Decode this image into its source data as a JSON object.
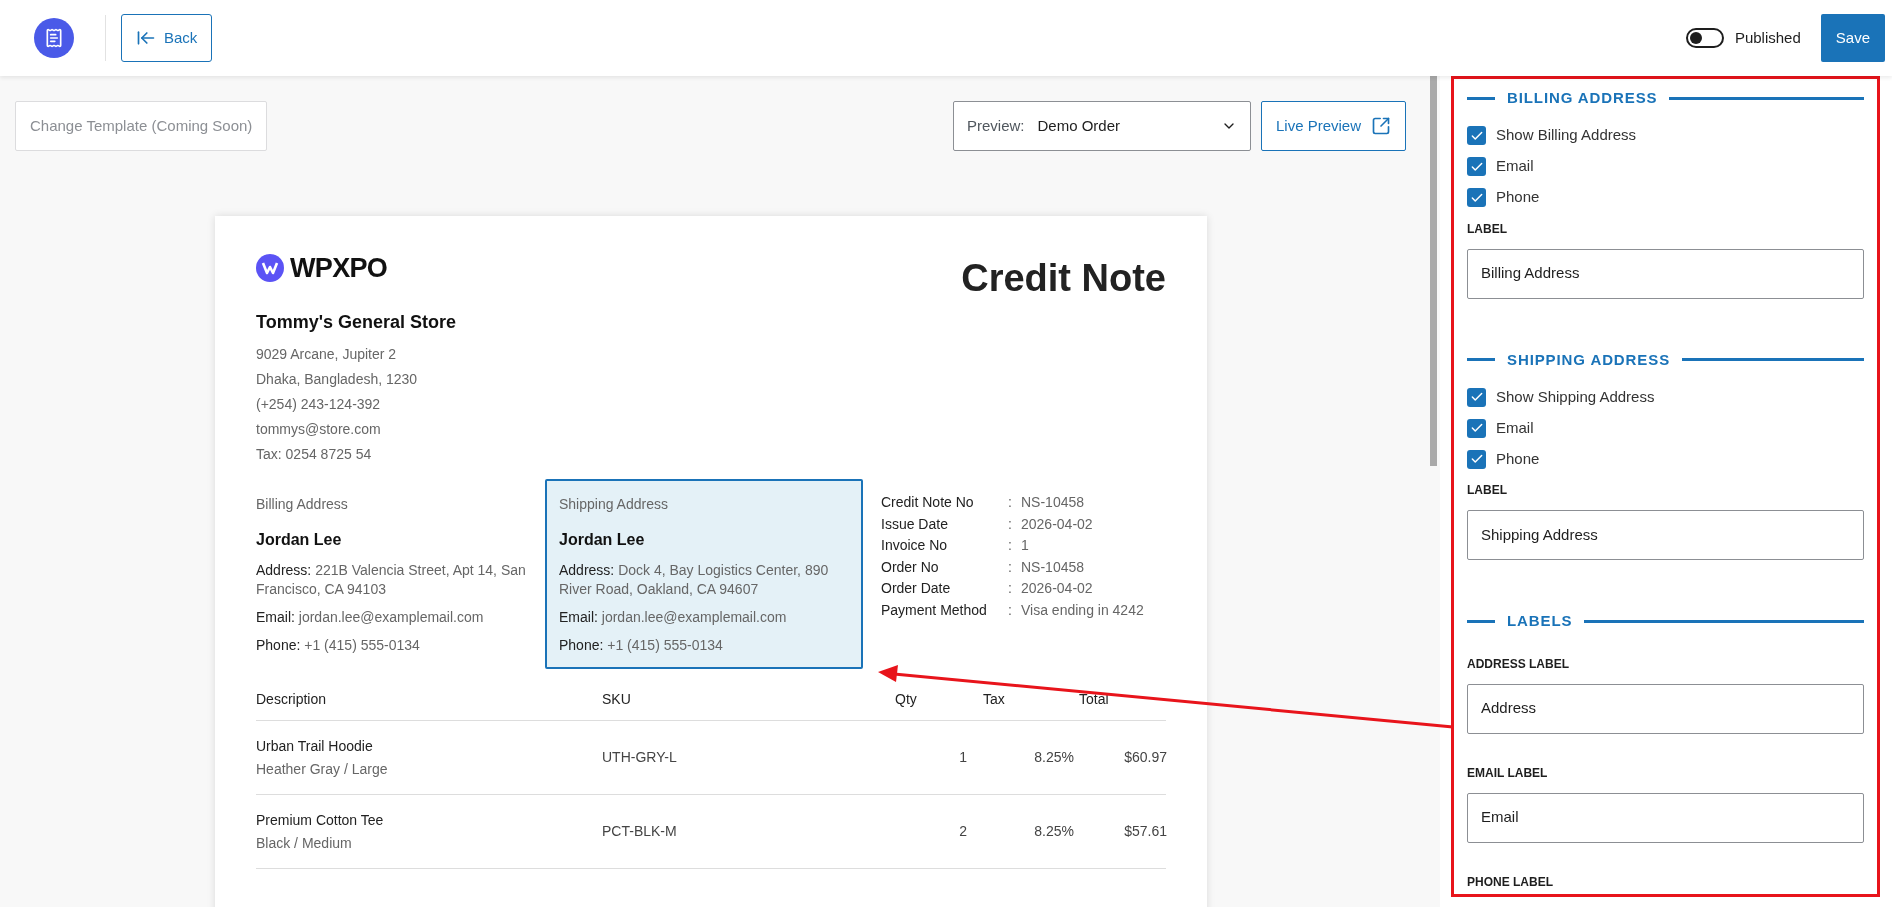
{
  "header": {
    "back": "Back",
    "published": {
      "label": "Published",
      "on": false
    },
    "save": "Save"
  },
  "toolbar": {
    "change_template": "Change Template (Coming Soon)",
    "preview": {
      "label": "Preview:",
      "value": "Demo Order"
    },
    "live_preview": "Live Preview"
  },
  "document": {
    "brand": "WPXPO",
    "title": "Credit Note",
    "store": {
      "name": "Tommy's General Store",
      "lines": [
        "9029 Arcane, Jupiter 2",
        "Dhaka, Bangladesh, 1230",
        "(+254) 243-124-392",
        "tommys@store.com",
        "Tax: 0254 8725 54"
      ]
    },
    "addresses": [
      {
        "heading": "Billing Address",
        "name": "Jordan Lee",
        "selected": false,
        "fields": [
          {
            "label": "Address:",
            "value": "221B Valencia Street, Apt 14, San Francisco, CA 94103"
          },
          {
            "label": "Email:",
            "value": "jordan.lee@examplemail.com"
          },
          {
            "label": "Phone:",
            "value": "+1 (415) 555-0134"
          }
        ]
      },
      {
        "heading": "Shipping Address",
        "name": "Jordan Lee",
        "selected": true,
        "fields": [
          {
            "label": "Address:",
            "value": "Dock 4, Bay Logistics Center, 890 River Road, Oakland, CA 94607"
          },
          {
            "label": "Email:",
            "value": "jordan.lee@examplemail.com"
          },
          {
            "label": "Phone:",
            "value": "+1 (415) 555-0134"
          }
        ]
      }
    ],
    "meta": [
      {
        "label": "Credit Note No",
        "separator": ":",
        "value": "NS-10458"
      },
      {
        "label": "Issue Date",
        "separator": ":",
        "value": "2026-04-02"
      },
      {
        "label": "Invoice No",
        "separator": ":",
        "value": "1"
      },
      {
        "label": "Order No",
        "separator": ":",
        "value": "NS-10458"
      },
      {
        "label": "Order Date",
        "separator": ":",
        "value": "2026-04-02"
      },
      {
        "label": "Payment Method",
        "separator": ":",
        "value": "Visa ending in 4242"
      }
    ],
    "table": {
      "columns": [
        "Description",
        "SKU",
        "Qty",
        "Tax",
        "Total"
      ],
      "rows": [
        {
          "description": "Urban Trail Hoodie",
          "variant": "Heather Gray / Large",
          "sku": "UTH-GRY-L",
          "qty": "1",
          "tax": "8.25%",
          "total": "$60.97"
        },
        {
          "description": "Premium Cotton Tee",
          "variant": "Black / Medium",
          "sku": "PCT-BLK-M",
          "qty": "2",
          "tax": "8.25%",
          "total": "$57.61"
        }
      ]
    }
  },
  "settings": {
    "sections": [
      {
        "title": "BILLING ADDRESS",
        "options": [
          {
            "label": "Show Billing Address",
            "checked": true
          },
          {
            "label": "Email",
            "checked": true
          },
          {
            "label": "Phone",
            "checked": true
          }
        ],
        "fields": [
          {
            "label": "LABEL",
            "value": "Billing Address"
          }
        ]
      },
      {
        "title": "SHIPPING ADDRESS",
        "options": [
          {
            "label": "Show Shipping Address",
            "checked": true
          },
          {
            "label": "Email",
            "checked": true
          },
          {
            "label": "Phone",
            "checked": true
          }
        ],
        "fields": [
          {
            "label": "LABEL",
            "value": "Shipping Address"
          }
        ]
      },
      {
        "title": "LABELS",
        "fields": [
          {
            "label": "ADDRESS LABEL",
            "value": "Address"
          },
          {
            "label": "EMAIL LABEL",
            "value": "Email"
          },
          {
            "label": "PHONE LABEL"
          }
        ]
      }
    ]
  }
}
